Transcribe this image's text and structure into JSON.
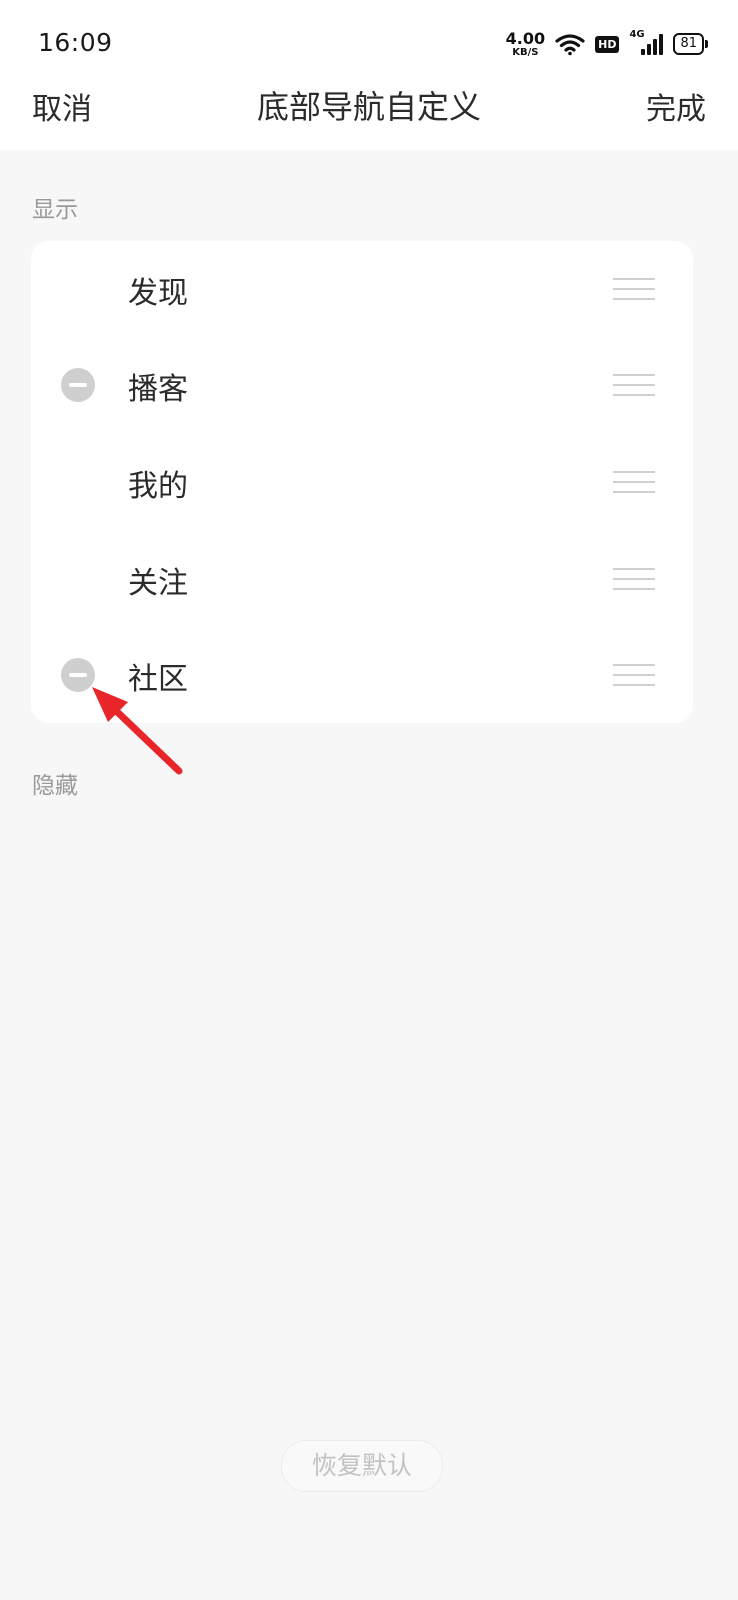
{
  "status_bar": {
    "time": "16:09",
    "net_speed_value": "4.00",
    "net_speed_unit": "KB/S",
    "hd_badge": "HD",
    "network_type": "4G",
    "battery_level": "81",
    "icons": [
      "wifi-icon",
      "hd-icon",
      "cellular-signal-icon",
      "battery-icon"
    ]
  },
  "header": {
    "cancel_label": "取消",
    "title": "底部导航自定义",
    "done_label": "完成"
  },
  "visible_section": {
    "label": "显示",
    "items": [
      {
        "label": "发现",
        "removable": false
      },
      {
        "label": "播客",
        "removable": true
      },
      {
        "label": "我的",
        "removable": false
      },
      {
        "label": "关注",
        "removable": false
      },
      {
        "label": "社区",
        "removable": true
      }
    ]
  },
  "hidden_section": {
    "label": "隐藏",
    "items": []
  },
  "restore_button": {
    "label": "恢复默认"
  },
  "annotation": {
    "arrow_color": "#e8262a"
  }
}
